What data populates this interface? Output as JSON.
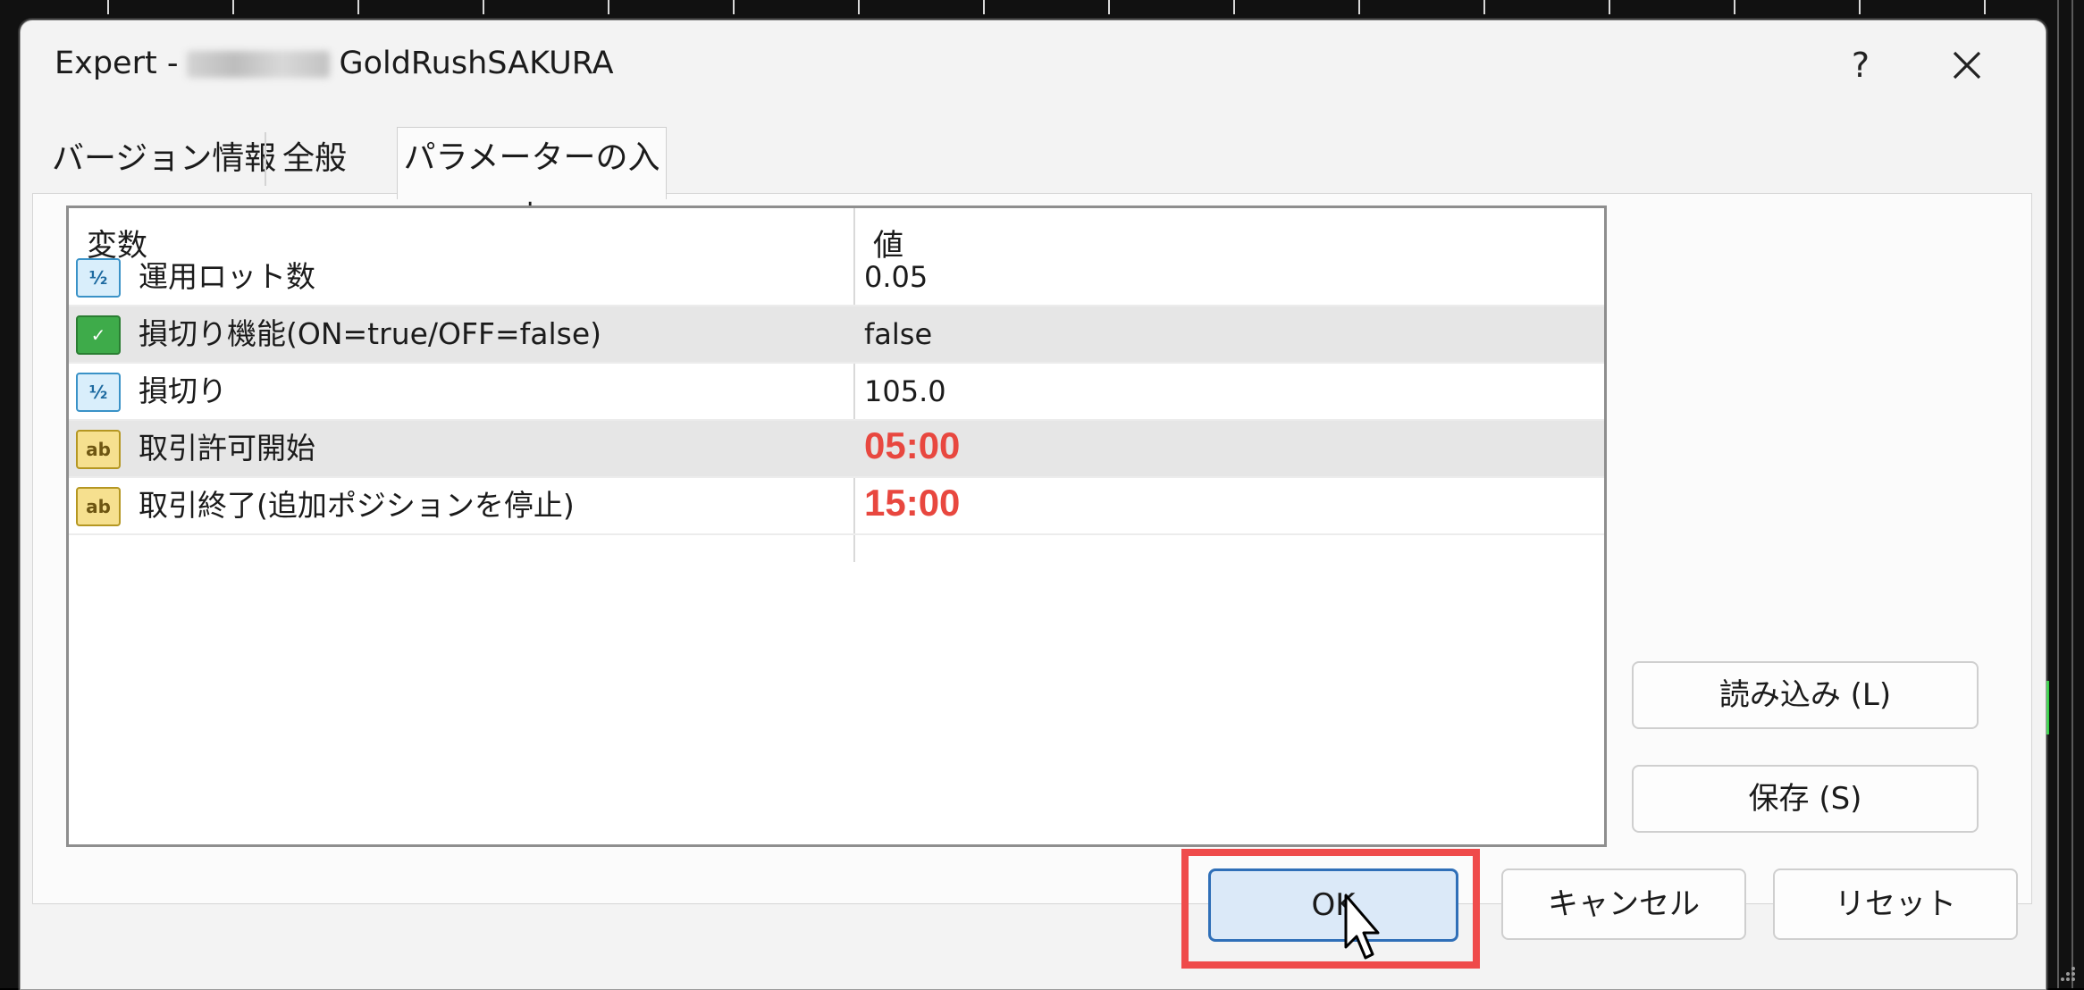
{
  "dialog": {
    "title_prefix": "Expert -",
    "title_name": "GoldRushSAKURA",
    "help_label": "?",
    "close_icon": "close-icon"
  },
  "tabs": [
    {
      "label": "バージョン情報",
      "active": false
    },
    {
      "label": "全般",
      "active": false
    },
    {
      "label": "パラメーターの入力",
      "active": true
    }
  ],
  "table": {
    "headers": {
      "variable": "変数",
      "value": "値"
    },
    "rows": [
      {
        "icon": "numeric-type-icon",
        "name": "運用ロット数",
        "value": "0.05"
      },
      {
        "icon": "boolean-type-icon",
        "name": "損切り機能(ON=true/OFF=false)",
        "value": "false"
      },
      {
        "icon": "numeric-type-icon",
        "name": "損切り",
        "value": "105.0"
      },
      {
        "icon": "string-type-icon",
        "name": "取引許可開始",
        "value": "05:00"
      },
      {
        "icon": "string-type-icon",
        "name": "取引終了(追加ポジションを停止)",
        "value": "15:00"
      }
    ]
  },
  "buttons": {
    "load": "読み込み (L)",
    "save": "保存 (S)",
    "ok": "OK",
    "cancel": "キャンセル",
    "reset": "リセット"
  },
  "icon_glyphs": {
    "numeric": "½",
    "boolean": "✓",
    "string": "ab"
  },
  "colors": {
    "highlight_value": "#e8473f",
    "ok_frame": "#ef4b4b",
    "ok_button_border": "#2f6fb8"
  }
}
